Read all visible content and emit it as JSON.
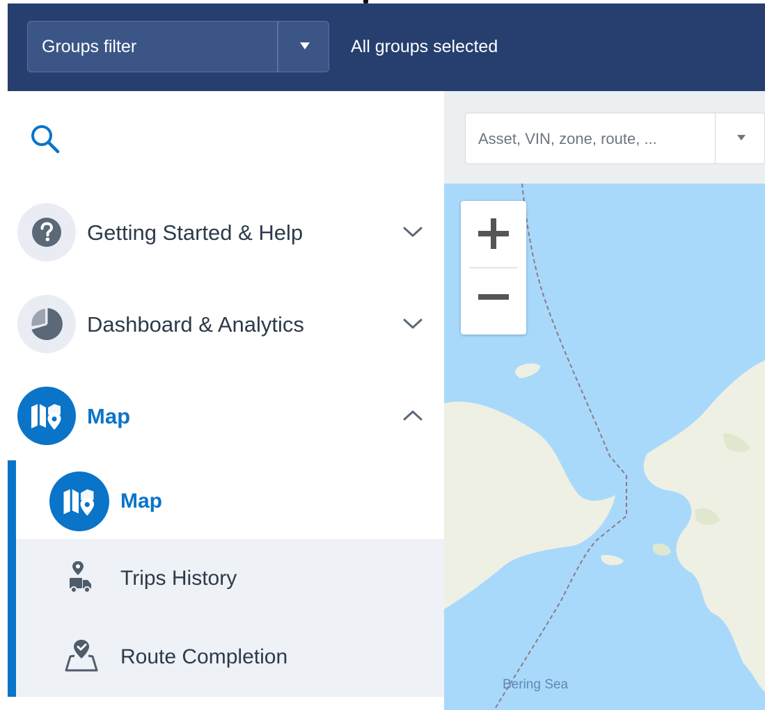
{
  "header": {
    "groups_filter_label": "Groups filter",
    "groups_status": "All groups selected"
  },
  "sidebar": {
    "search": {
      "value": ""
    },
    "nav": [
      {
        "label": "Getting Started & Help",
        "icon": "help-circle-icon",
        "expanded": false
      },
      {
        "label": "Dashboard & Analytics",
        "icon": "pie-chart-icon",
        "expanded": false
      },
      {
        "label": "Map",
        "icon": "map-pin-icon",
        "expanded": true,
        "active": true
      }
    ],
    "map_subitems": [
      {
        "label": "Map",
        "icon": "map-pin-icon",
        "active": true
      },
      {
        "label": "Trips History",
        "icon": "truck-pin-icon"
      },
      {
        "label": "Route Completion",
        "icon": "route-check-icon"
      }
    ]
  },
  "map": {
    "search_placeholder": "Asset, VIN, zone, route, ...",
    "labels": {
      "sea": "Bering Sea"
    }
  },
  "colors": {
    "header_bg": "#263f6e",
    "accent": "#0a74c8",
    "water": "#a8d9fb",
    "land": "#eef0e4"
  }
}
